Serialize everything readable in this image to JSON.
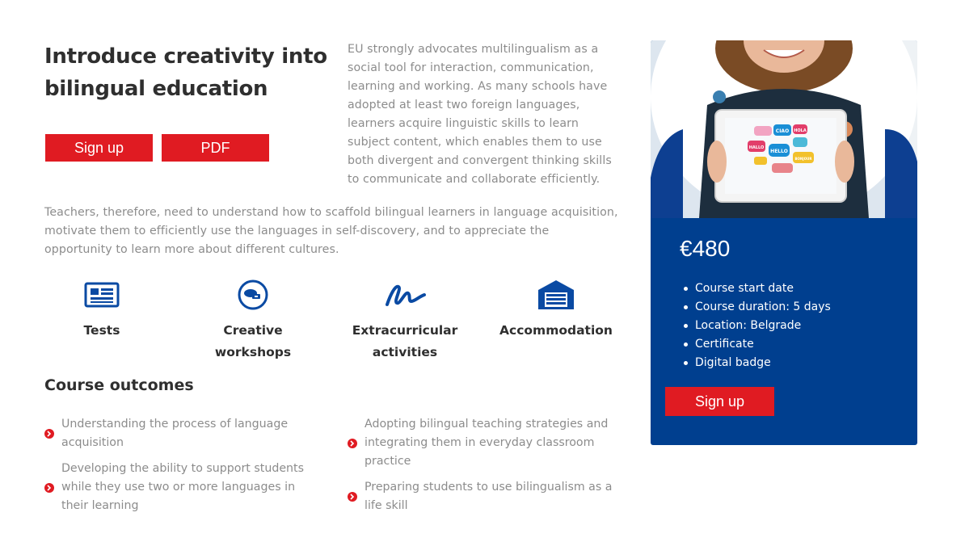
{
  "header": {
    "title": "Introduce creativity into bilingual education",
    "signup_label": "Sign up",
    "pdf_label": "PDF"
  },
  "intro_text": "EU strongly advocates multilingualism as a social tool for interaction, communication, learning and working. As many schools have adopted at least two foreign languages, learners acquire linguistic skills to learn subject content, which enables them to use both divergent and convergent thinking skills to communicate and collaborate efficiently.",
  "teachers_text": "Teachers, therefore, need to understand how to scaffold bilingual learners in language acquisition, motivate them to efficiently use the languages in self-discovery, and to appreciate the opportunity to learn more about different cultures.",
  "features": [
    {
      "label": "Tests",
      "icon": "newspaper-icon"
    },
    {
      "label": "Creative workshops",
      "icon": "workshop-icon"
    },
    {
      "label": "Extracurricular activities",
      "icon": "signature-icon"
    },
    {
      "label": "Accommodation",
      "icon": "garage-icon"
    }
  ],
  "outcomes": {
    "title": "Course outcomes",
    "items": [
      "Understanding the process of language acquisition",
      "Developing the ability to support students while they use two or more languages in their learning",
      "Adopting bilingual teaching strategies and integrating them in everyday classroom practice",
      "Preparing students to use bilingualism as a life skill"
    ]
  },
  "card": {
    "price": "€480",
    "details": [
      "Course start date",
      "Course duration: 5 days",
      "Location: Belgrade",
      "Certificate",
      "Digital badge"
    ],
    "signup_label": "Sign up",
    "photo_bubbles": [
      "CIAO",
      "HOLA",
      "HALLO",
      "HELLO",
      "BONJOUR"
    ]
  },
  "colors": {
    "accent": "#e01b22",
    "card_blue": "#003f8f",
    "icon_blue": "#0a4aa3",
    "body_text": "#8c8c8c",
    "heading_text": "#2f2f2f"
  }
}
